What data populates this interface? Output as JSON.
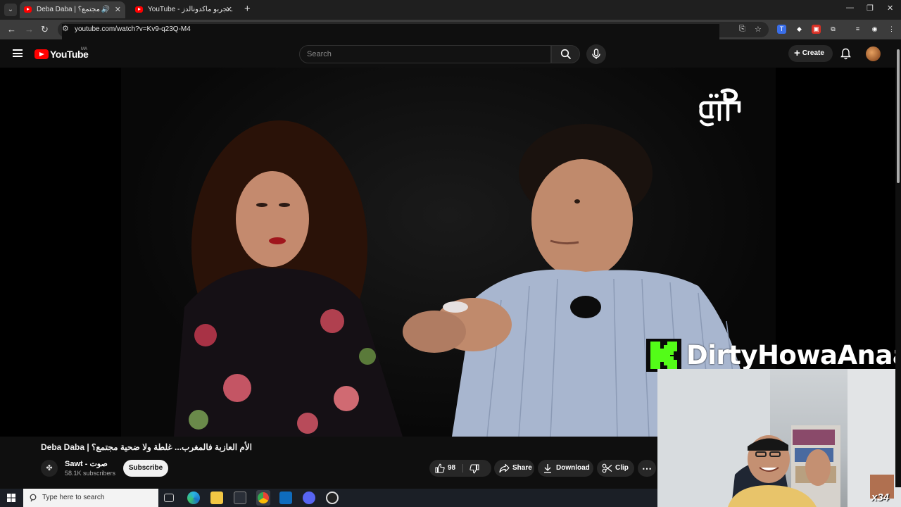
{
  "browser": {
    "tabs": [
      {
        "title": "Deba Daba | ضحية مجتمع؟",
        "active": true,
        "audio": true
      },
      {
        "title": "YouTube - اجي نجربو ماكدونالدز",
        "active": false,
        "audio": false
      }
    ],
    "url": "youtube.com/watch?v=Kv9-q23Q-M4",
    "nav_icons": [
      "back-icon",
      "forward-icon",
      "reload-icon"
    ],
    "omnibox_icons": [
      "cast-icon",
      "bookmark-star-icon"
    ],
    "extension_icons": [
      "translate-icon",
      "extension-diamond-icon",
      "extension-red-icon",
      "puzzle-icon",
      "media-icon",
      "profile-icon",
      "more-icon"
    ]
  },
  "youtube": {
    "logo_text": "YouTube",
    "country_code": "MA",
    "search_placeholder": "Search",
    "create_label": "Create"
  },
  "overlays": {
    "watermark_text": "صوت",
    "kick_username": "DirtyHowaAnaa",
    "multiplier": "x34"
  },
  "video": {
    "title": "Deba Daba | الأم العازبة فالمغرب... غلطة ولا ضحية مجتمع؟",
    "channel_name": "Sawt - صوت",
    "subscribers": "58.1K subscribers",
    "subscribe_label": "Subscribe",
    "likes": "98",
    "share_label": "Share",
    "download_label": "Download",
    "clip_label": "Clip"
  },
  "taskbar": {
    "search_placeholder": "Type here to search",
    "apps": [
      "task-view-icon",
      "edge-icon",
      "file-explorer-icon",
      "store-icon",
      "chrome-icon",
      "outlook-icon",
      "app-icon-1",
      "app-icon-2"
    ]
  },
  "colors": {
    "youtube_red": "#ff0000",
    "kick_green": "#53fc18",
    "background": "#0f0f0f"
  }
}
